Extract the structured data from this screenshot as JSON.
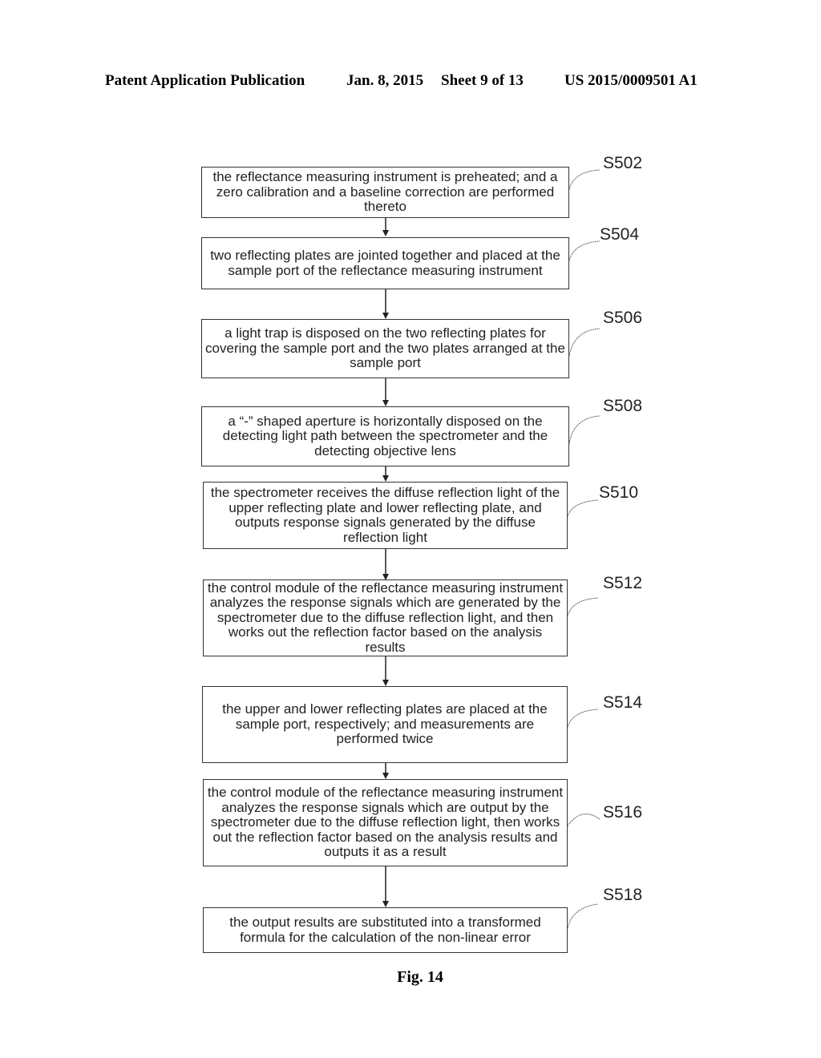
{
  "header": {
    "publication": "Patent Application Publication",
    "date": "Jan. 8, 2015",
    "sheet": "Sheet 9 of 13",
    "patent_number": "US 2015/0009501 A1"
  },
  "flowchart": {
    "steps": [
      {
        "id": "S502",
        "text": "the reflectance measuring instrument is preheated; and a zero calibration and a baseline correction are performed thereto"
      },
      {
        "id": "S504",
        "text": "two reflecting plates are jointed together and placed at the sample port of the reflectance measuring instrument"
      },
      {
        "id": "S506",
        "text": "a light trap is disposed on the two reflecting plates for covering the sample port and the two plates arranged at the sample port"
      },
      {
        "id": "S508",
        "text": "a “-” shaped aperture is horizontally disposed on the detecting light path between the spectrometer and the detecting objective lens"
      },
      {
        "id": "S510",
        "text": "the spectrometer receives the diffuse reflection light of the upper reflecting plate and lower reflecting plate, and outputs response signals generated by the diffuse reflection light"
      },
      {
        "id": "S512",
        "text": "the control module of the reflectance measuring instrument analyzes the response signals which are generated by the spectrometer due to the diffuse reflection light, and then works out the reflection factor based on the analysis results"
      },
      {
        "id": "S514",
        "text": "the upper and lower reflecting plates are placed at the sample port, respectively; and measurements are performed twice"
      },
      {
        "id": "S516",
        "text": "the control module of the reflectance measuring instrument analyzes the response signals which are output by the spectrometer due to the diffuse reflection light, then works out the reflection factor based on the analysis results and outputs it as a result"
      },
      {
        "id": "S518",
        "text": "the output results are substituted into a transformed formula for the calculation of the non-linear error"
      }
    ]
  },
  "caption": "Fig. 14"
}
